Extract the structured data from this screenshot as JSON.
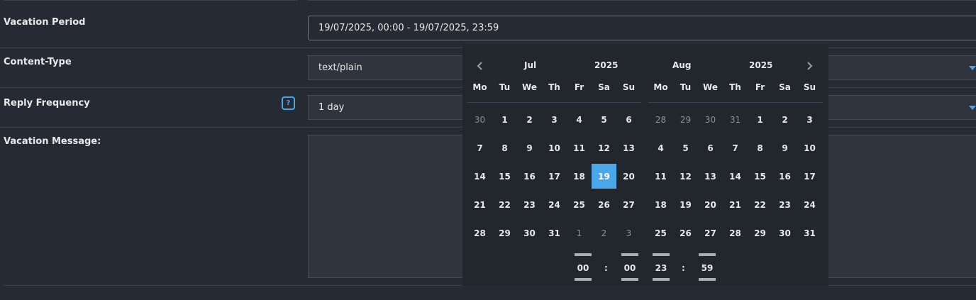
{
  "form": {
    "vacation_period": {
      "label": "Vacation Period",
      "value": "19/07/2025, 00:00 - 19/07/2025, 23:59"
    },
    "content_type": {
      "label": "Content-Type",
      "value": "text/plain"
    },
    "reply_frequency": {
      "label": "Reply Frequency",
      "value": "1 day",
      "help_icon": "?"
    },
    "vacation_message": {
      "label": "Vacation Message:",
      "value": ""
    }
  },
  "datepicker": {
    "weekdays": [
      "Mo",
      "Tu",
      "We",
      "Th",
      "Fr",
      "Sa",
      "Su"
    ],
    "left": {
      "month": "Jul",
      "year": "2025",
      "weeks": [
        [
          "30",
          "1",
          "2",
          "3",
          "4",
          "5",
          "6"
        ],
        [
          "7",
          "8",
          "9",
          "10",
          "11",
          "12",
          "13"
        ],
        [
          "14",
          "15",
          "16",
          "17",
          "18",
          "19",
          "20"
        ],
        [
          "21",
          "22",
          "23",
          "24",
          "25",
          "26",
          "27"
        ],
        [
          "28",
          "29",
          "30",
          "31",
          "1",
          "2",
          "3"
        ]
      ],
      "off_days": [
        [
          0,
          0
        ],
        [
          4,
          4
        ],
        [
          4,
          5
        ],
        [
          4,
          6
        ]
      ],
      "selected": [
        2,
        5
      ]
    },
    "right": {
      "month": "Aug",
      "year": "2025",
      "weeks": [
        [
          "28",
          "29",
          "30",
          "31",
          "1",
          "2",
          "3"
        ],
        [
          "4",
          "5",
          "6",
          "7",
          "8",
          "9",
          "10"
        ],
        [
          "11",
          "12",
          "13",
          "14",
          "15",
          "16",
          "17"
        ],
        [
          "18",
          "19",
          "20",
          "21",
          "22",
          "23",
          "24"
        ],
        [
          "25",
          "26",
          "27",
          "28",
          "29",
          "30",
          "31"
        ]
      ],
      "off_days": [
        [
          0,
          0
        ],
        [
          0,
          1
        ],
        [
          0,
          2
        ],
        [
          0,
          3
        ]
      ],
      "selected": null
    },
    "time": {
      "start_hour": "00",
      "start_minute": "00",
      "end_hour": "23",
      "end_minute": "59",
      "separator": ":"
    }
  },
  "colors": {
    "accent": "#4aa8e8",
    "background": "#262a33",
    "popup": "#22262d"
  }
}
